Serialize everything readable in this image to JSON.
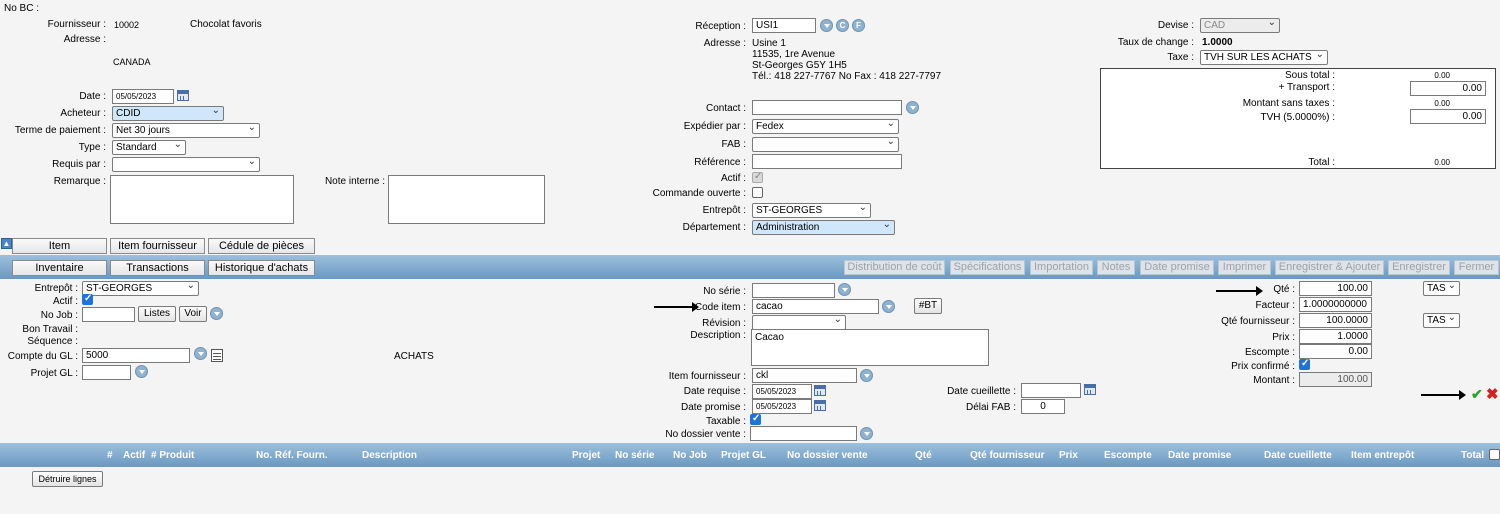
{
  "header": {
    "no_bc_label": "No BC :",
    "fournisseur_label": "Fournisseur :",
    "fournisseur_code": "10002",
    "fournisseur_name": "Chocolat favoris",
    "adresse_label": "Adresse :",
    "country": "CANADA",
    "date_label": "Date :",
    "date_value": "05/05/2023",
    "acheteur_label": "Acheteur :",
    "acheteur_value": "CDID",
    "terme_label": "Terme de paiement :",
    "terme_value": "Net 30 jours",
    "type_label": "Type :",
    "type_value": "Standard",
    "requis_label": "Requis par :",
    "requis_value": "",
    "remarque_label": "Remarque :",
    "note_interne_label": "Note interne :",
    "reception_label": "Réception :",
    "reception_value": "USI1",
    "reception_btn_c": "C",
    "reception_btn_f": "F",
    "adresse2_label": "Adresse :",
    "addr_line1": "Usine 1",
    "addr_line2": "11535, 1re Avenue",
    "addr_line3": "St-Georges  G5Y 1H5",
    "addr_line4": "Tél.: 418 227-7767    No Fax : 418 227-7797",
    "contact_label": "Contact :",
    "expedier_label": "Expédier par :",
    "expedier_value": "Fedex",
    "fab_label": "FAB :",
    "reference_label": "Référence :",
    "actif_label": "Actif :",
    "commande_ouverte_label": "Commande ouverte :",
    "entrepot_label": "Entrepôt :",
    "entrepot_value": "ST-GEORGES",
    "departement_label": "Département :",
    "departement_value": "Administration",
    "devise_label": "Devise :",
    "devise_value": "CAD",
    "taux_label": "Taux de change :",
    "taux_value": "1.0000",
    "taxe_label": "Taxe :",
    "taxe_value": "TVH SUR LES ACHATS"
  },
  "totals": {
    "sous_total_label": "Sous total :",
    "sous_total_value": "0.00",
    "transport_label": "+ Transport :",
    "transport_value": "0.00",
    "montant_st_label": "Montant sans taxes :",
    "montant_st_value": "0.00",
    "tvh_label": "TVH (5.0000%) :",
    "tvh_value": "0.00",
    "total_label": "Total :",
    "total_value": "0.00"
  },
  "tabs_row1": [
    "Item",
    "Item fournisseur",
    "Cédule de pièces"
  ],
  "tabs_row2": [
    "Inventaire",
    "Transactions",
    "Historique d'achats"
  ],
  "toolbar": [
    "Distribution de coût",
    "Spécifications",
    "Importation",
    "Notes",
    "Date promise",
    "Imprimer",
    "Enregistrer & Ajouter",
    "Enregistrer",
    "Fermer"
  ],
  "item": {
    "entrepot_label": "Entrepôt :",
    "entrepot_value": "ST-GEORGES",
    "actif_label": "Actif :",
    "nojob_label": "No Job :",
    "nojob_value": "",
    "listes_btn": "Listes",
    "voir_btn": "Voir",
    "bon_travail_label": "Bon Travail :",
    "sequence_label": "Séquence :",
    "compte_gl_label": "Compte du GL :",
    "compte_gl_value": "5000",
    "compte_gl_desc": "ACHATS",
    "projet_gl_label": "Projet GL :",
    "projet_gl_value": "",
    "no_serie_label": "No série :",
    "no_serie_value": "",
    "code_item_label": "Code item :",
    "code_item_value": "cacao",
    "bt_btn": "#BT",
    "revision_label": "Révision :",
    "description_label": "Description :",
    "description_value": "Cacao",
    "item_fourn_label": "Item fournisseur :",
    "item_fourn_value": "ckl",
    "date_requise_label": "Date requise :",
    "date_requise_value": "05/05/2023",
    "date_promise_label": "Date promise :",
    "date_promise_value": "05/05/2023",
    "taxable_label": "Taxable :",
    "no_dossier_label": "No dossier vente :",
    "no_dossier_value": "",
    "date_cueillette_label": "Date cueillette :",
    "date_cueillette_value": "",
    "delai_fab_label": "Délai FAB :",
    "delai_fab_value": "0",
    "qte_label": "Qté :",
    "qte_value": "100.00",
    "qte_unit": "TAS",
    "facteur_label": "Facteur :",
    "facteur_value": "1.0000000000",
    "qte_fourn_label": "Qté fournisseur :",
    "qte_fourn_value": "100.0000",
    "qte_fourn_unit": "TAS",
    "prix_label": "Prix :",
    "prix_value": "1.0000",
    "escompte_label": "Escompte :",
    "escompte_value": "0.00",
    "prix_confirme_label": "Prix confirmé :",
    "montant_label": "Montant :",
    "montant_value": "100.00"
  },
  "grid_columns": [
    "#",
    "Actif",
    "# Produit",
    "No. Réf. Fourn.",
    "Description",
    "Projet",
    "No série",
    "No Job",
    "Projet GL",
    "No dossier vente",
    "Qté",
    "Qté fournisseur",
    "Prix",
    "Escompte",
    "Date promise",
    "Date cueillette",
    "Item entrepôt",
    "Total"
  ],
  "detruire_btn": "Détruire lignes",
  "colors": {
    "bar_top": "#9cc0dd",
    "bar_bottom": "#6b98c1",
    "accept": "#2aa62a",
    "cancel": "#d42020"
  }
}
